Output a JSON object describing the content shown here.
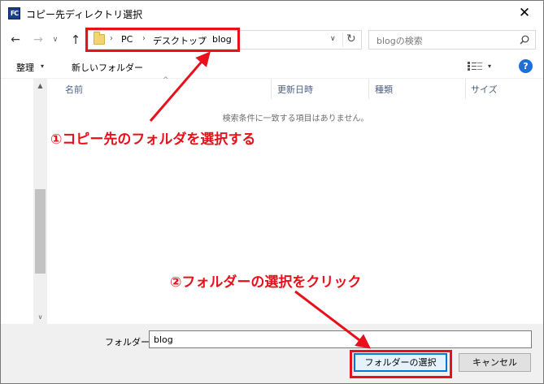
{
  "window": {
    "title": "コピー先ディレクトリ選択",
    "app_icon_text": "FC",
    "close_glyph": "✕"
  },
  "nav": {
    "back_glyph": "←",
    "forward_glyph": "→",
    "recent_glyph": "∨",
    "up_glyph": "↑",
    "breadcrumb": [
      "PC",
      "デスクトップ",
      "blog"
    ],
    "separator": "›",
    "dropdown_glyph": "∨",
    "refresh_glyph": "↻",
    "search_placeholder": "blogの検索"
  },
  "toolbar": {
    "organize_label": "整理",
    "caret": "▾",
    "new_folder_label": "新しいフォルダー",
    "help_label": "?"
  },
  "filelist": {
    "columns": [
      "名前",
      "更新日時",
      "種類",
      "サイズ"
    ],
    "sort_glyph": "^",
    "empty_message": "検索条件に一致する項目はありません。"
  },
  "scrollbar": {
    "up_glyph": "▲",
    "down_glyph": "∨"
  },
  "bottom": {
    "folder_label": "フォルダー:",
    "folder_value": "blog",
    "select_button": "フォルダーの選択",
    "cancel_button": "キャンセル"
  },
  "annotations": {
    "step1": "①コピー先のフォルダを選択する",
    "step2": "②フォルダーの選択をクリック",
    "color": "#e8101b"
  }
}
